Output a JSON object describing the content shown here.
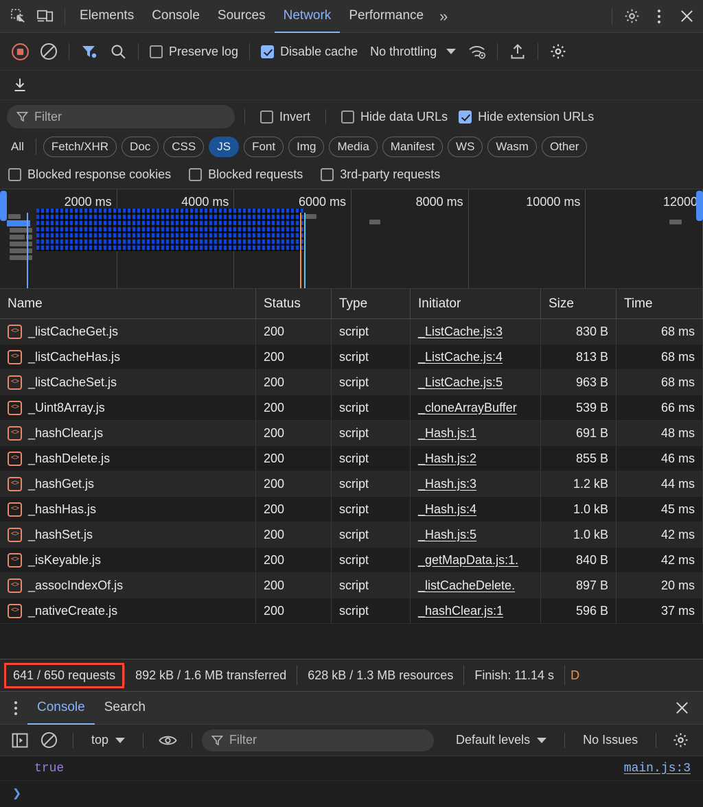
{
  "tabbar": {
    "icons": [
      {
        "name": "inspect-element-icon"
      },
      {
        "name": "device-toolbar-icon"
      }
    ],
    "tabs": [
      {
        "label": "Elements",
        "active": false
      },
      {
        "label": "Console",
        "active": false
      },
      {
        "label": "Sources",
        "active": false
      },
      {
        "label": "Network",
        "active": true
      },
      {
        "label": "Performance",
        "active": false
      }
    ],
    "more_label": "»",
    "settings_icon": "gear-icon",
    "kebab_icon": "more-vertical-icon",
    "close_icon": "close-icon"
  },
  "network_toolbar": {
    "record_icon": "record-stop-icon",
    "clear_icon": "clear-icon",
    "filter_icon": "filter-funnel-icon",
    "search_icon": "search-icon",
    "preserve_log_label": "Preserve log",
    "preserve_log_checked": false,
    "disable_cache_label": "Disable cache",
    "disable_cache_checked": true,
    "throttling_label": "No throttling",
    "network_conditions_icon": "wifi-gear-icon",
    "export_har_icon": "upload-icon",
    "settings_icon": "gear-icon",
    "import_har_icon": "download-icon"
  },
  "filter_row": {
    "placeholder": "Filter",
    "filter_value": "",
    "invert_label": "Invert",
    "invert_checked": false,
    "hide_data_urls_label": "Hide data URLs",
    "hide_data_urls_checked": false,
    "hide_extension_urls_label": "Hide extension URLs",
    "hide_extension_urls_checked": true
  },
  "type_chips": [
    {
      "label": "All",
      "selected": false
    },
    {
      "label": "Fetch/XHR",
      "selected": false
    },
    {
      "label": "Doc",
      "selected": false
    },
    {
      "label": "CSS",
      "selected": false
    },
    {
      "label": "JS",
      "selected": true
    },
    {
      "label": "Font",
      "selected": false
    },
    {
      "label": "Img",
      "selected": false
    },
    {
      "label": "Media",
      "selected": false
    },
    {
      "label": "Manifest",
      "selected": false
    },
    {
      "label": "WS",
      "selected": false
    },
    {
      "label": "Wasm",
      "selected": false
    },
    {
      "label": "Other",
      "selected": false
    }
  ],
  "blocked_row": [
    {
      "label": "Blocked response cookies",
      "checked": false
    },
    {
      "label": "Blocked requests",
      "checked": false
    },
    {
      "label": "3rd-party requests",
      "checked": false
    }
  ],
  "overview": {
    "ticks": [
      "2000 ms",
      "4000 ms",
      "6000 ms",
      "8000 ms",
      "10000 ms",
      "12000"
    ],
    "dcl_color": "#4b8bf5",
    "load_color": "#f4903f"
  },
  "table": {
    "columns": [
      "Name",
      "Status",
      "Type",
      "Initiator",
      "Size",
      "Time"
    ],
    "rows": [
      {
        "icon": "js-script-icon",
        "name": "_listCacheGet.js",
        "status": "200",
        "type": "script",
        "initiator": "_ListCache.js:3",
        "size": "830 B",
        "time": "68 ms"
      },
      {
        "icon": "js-script-icon",
        "name": "_listCacheHas.js",
        "status": "200",
        "type": "script",
        "initiator": "_ListCache.js:4",
        "size": "813 B",
        "time": "68 ms"
      },
      {
        "icon": "js-script-icon",
        "name": "_listCacheSet.js",
        "status": "200",
        "type": "script",
        "initiator": "_ListCache.js:5",
        "size": "963 B",
        "time": "68 ms"
      },
      {
        "icon": "js-script-icon",
        "name": "_Uint8Array.js",
        "status": "200",
        "type": "script",
        "initiator": "_cloneArrayBuffer",
        "size": "539 B",
        "time": "66 ms"
      },
      {
        "icon": "js-script-icon",
        "name": "_hashClear.js",
        "status": "200",
        "type": "script",
        "initiator": "_Hash.js:1",
        "size": "691 B",
        "time": "48 ms"
      },
      {
        "icon": "js-script-icon",
        "name": "_hashDelete.js",
        "status": "200",
        "type": "script",
        "initiator": "_Hash.js:2",
        "size": "855 B",
        "time": "46 ms"
      },
      {
        "icon": "js-script-icon",
        "name": "_hashGet.js",
        "status": "200",
        "type": "script",
        "initiator": "_Hash.js:3",
        "size": "1.2 kB",
        "time": "44 ms"
      },
      {
        "icon": "js-script-icon",
        "name": "_hashHas.js",
        "status": "200",
        "type": "script",
        "initiator": "_Hash.js:4",
        "size": "1.0 kB",
        "time": "45 ms"
      },
      {
        "icon": "js-script-icon",
        "name": "_hashSet.js",
        "status": "200",
        "type": "script",
        "initiator": "_Hash.js:5",
        "size": "1.0 kB",
        "time": "42 ms"
      },
      {
        "icon": "js-script-icon",
        "name": "_isKeyable.js",
        "status": "200",
        "type": "script",
        "initiator": "_getMapData.js:1.",
        "size": "840 B",
        "time": "42 ms"
      },
      {
        "icon": "js-script-icon",
        "name": "_assocIndexOf.js",
        "status": "200",
        "type": "script",
        "initiator": "_listCacheDelete.",
        "size": "897 B",
        "time": "20 ms"
      },
      {
        "icon": "js-script-icon",
        "name": "_nativeCreate.js",
        "status": "200",
        "type": "script",
        "initiator": "_hashClear.js:1",
        "size": "596 B",
        "time": "37 ms"
      }
    ]
  },
  "summary": {
    "requests": "641 / 650 requests",
    "transferred": "892 kB / 1.6 MB transferred",
    "resources": "628 kB / 1.3 MB resources",
    "finish": "Finish: 11.14 s",
    "dcl_partial": "D",
    "highlight_color": "#ff4433"
  },
  "drawer": {
    "kebab_icon": "more-vertical-icon",
    "tabs": [
      {
        "label": "Console",
        "active": true
      },
      {
        "label": "Search",
        "active": false
      }
    ],
    "close_icon": "close-icon",
    "sidebar_icon": "show-sidebar-icon",
    "clear_icon": "clear-console-icon",
    "context_label": "top",
    "eye_icon": "live-expression-icon",
    "filter_placeholder": "Filter",
    "filter_value": "",
    "levels_label": "Default levels",
    "issues_label": "No Issues",
    "settings_icon": "gear-icon",
    "messages": [
      {
        "value": "true",
        "source": "main.js:3"
      }
    ],
    "prompt": "❯"
  }
}
